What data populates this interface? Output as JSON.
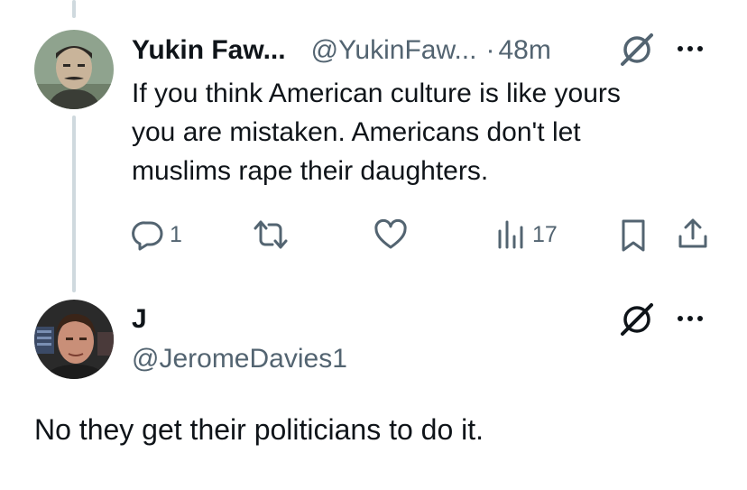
{
  "tweet1": {
    "display_name": "Yukin Faw...",
    "handle": "@YukinFaw...",
    "separator": "·",
    "time": "48m",
    "text_lines": [
      "If you think American culture is like yours",
      "you are mistaken. Americans don't let",
      "muslims rape their daughters."
    ],
    "actions": {
      "reply_count": "1",
      "retweet_count": "",
      "like_count": "",
      "views_count": "17"
    },
    "avatar_icon": "avatar-portrait",
    "badge_icon": "grok-icon",
    "more_icon": "more-icon"
  },
  "tweet2": {
    "display_name": "J",
    "handle": "@JeromeDavies1",
    "text": "No they get their politicians to do it.",
    "avatar_icon": "avatar-portrait",
    "badge_icon": "grok-icon",
    "more_icon": "more-icon"
  },
  "colors": {
    "text_primary": "#0f1419",
    "text_secondary": "#536471",
    "thread_line": "#cfd9de",
    "background": "#ffffff"
  }
}
